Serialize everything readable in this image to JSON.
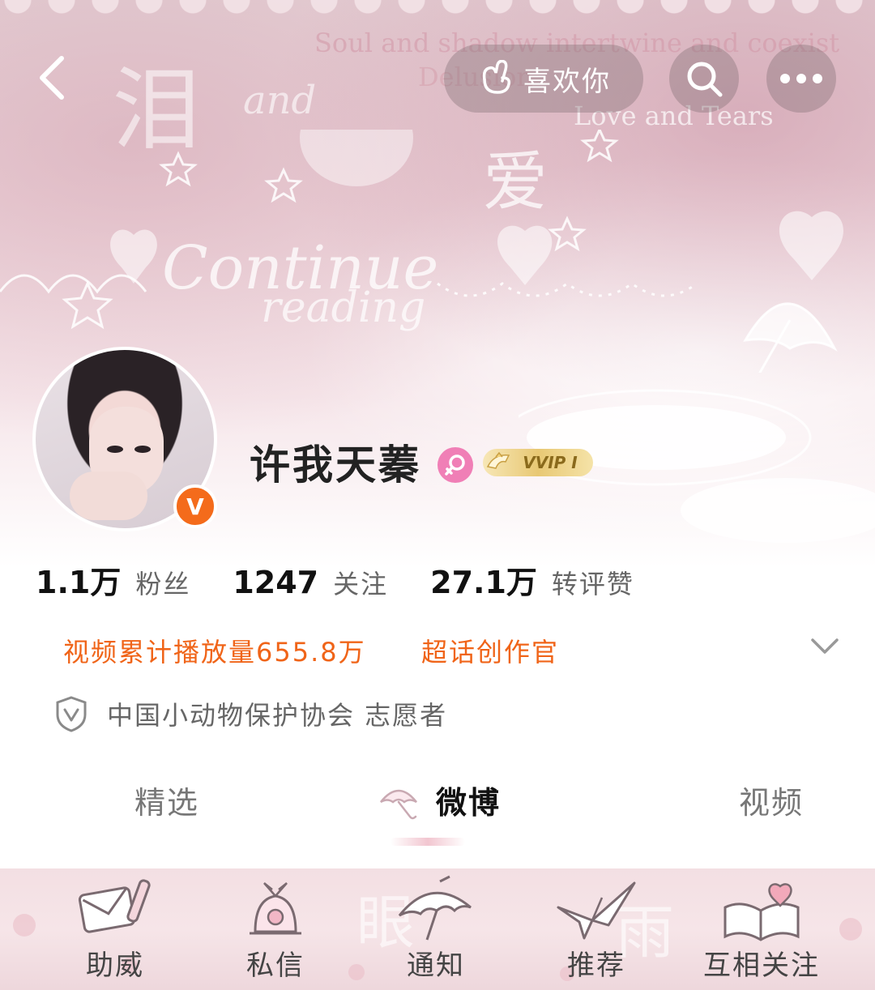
{
  "nav": {
    "like_label": "喜欢你"
  },
  "banner": {
    "text_lines": [
      "Soul and shadow intertwine and coexist",
      "Delusion",
      "Love and Tears"
    ],
    "big_left": "泪",
    "and_text": "and",
    "big_right": "爱",
    "continue_text": "Continue",
    "reading_text": "reading"
  },
  "profile": {
    "username": "许我天蓁",
    "verified_mark": "V",
    "vip_label": "VVIP I"
  },
  "stats": [
    {
      "num": "1.1万",
      "label": "粉丝"
    },
    {
      "num": "1247",
      "label": "关注"
    },
    {
      "num": "27.1万",
      "label": "转评赞"
    }
  ],
  "tags": {
    "video_plays": "视频累计播放量655.8万",
    "super_topic": "超话创作官"
  },
  "volunteer": "中国小动物保护协会 志愿者",
  "tabs": {
    "featured": "精选",
    "weibo": "微博",
    "video": "视频"
  },
  "bottom_nav": [
    {
      "label": "助威",
      "icon": "envelope-pen-icon"
    },
    {
      "label": "私信",
      "icon": "bell-ribbon-icon"
    },
    {
      "label": "通知",
      "icon": "umbrella-icon"
    },
    {
      "label": "推荐",
      "icon": "paper-crane-icon"
    },
    {
      "label": "互相关注",
      "icon": "book-heart-icon"
    }
  ],
  "colors": {
    "accent_orange": "#f06418",
    "verified_orange": "#f46b1b",
    "female_pink": "#f07fb6",
    "vip_gold": "#e8c874"
  }
}
